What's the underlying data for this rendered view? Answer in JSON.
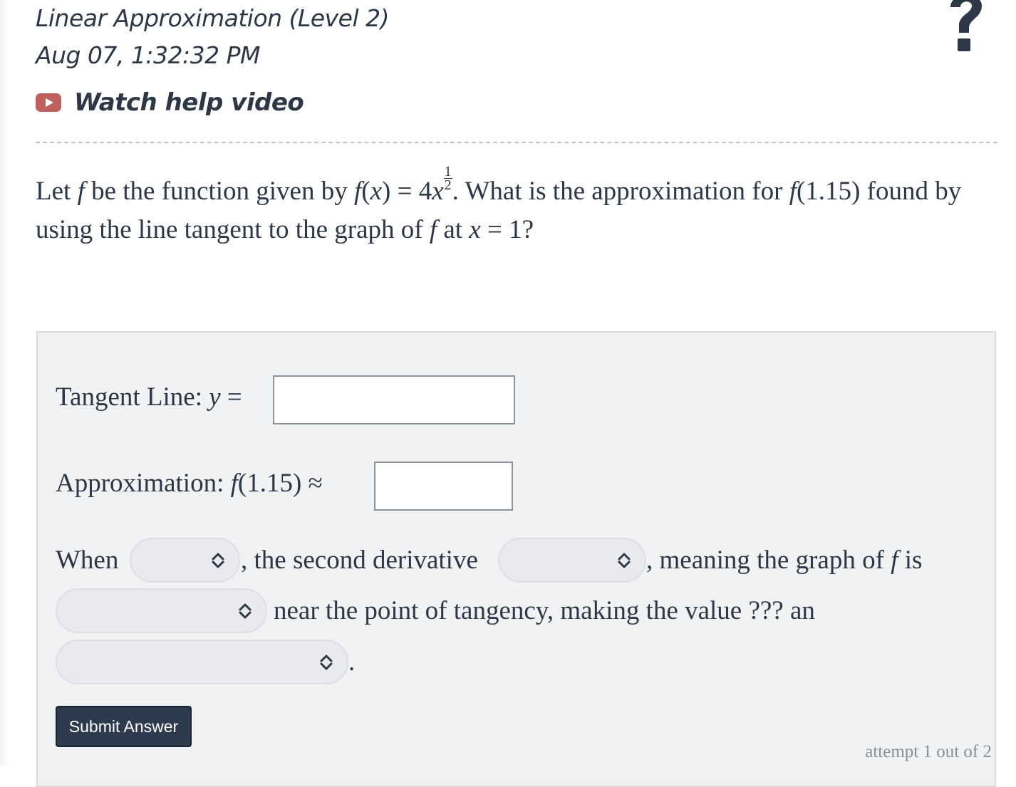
{
  "header": {
    "title": "Linear Approximation (Level 2)",
    "timestamp": "Aug 07, 1:32:32 PM",
    "help_icon": "question-mark-icon",
    "video_icon": "play-video-icon",
    "video_label": "Watch help video"
  },
  "question": {
    "p1": "Let ",
    "f": "f",
    "p2": " be the function given by ",
    "fx_open": "(",
    "x": "x",
    "fx_close": ")",
    "eq": " = 4",
    "exp_num": "1",
    "exp_den": "2",
    "p3": ". What is the approximation for ",
    "arg": "(1.15)",
    "p4": " found by using the line tangent to the graph of ",
    "p5": " at ",
    "p6": " = 1?"
  },
  "form": {
    "tangent_label": "Tangent Line: ",
    "tangent_var": "y",
    "tangent_eq": " =",
    "approx_label": "Approximation: ",
    "approx_f": "f",
    "approx_arg": "(1.15) ≈",
    "tangent_value": "",
    "approx_value": "",
    "s_when": "When",
    "s_second": ", the second derivative",
    "s_meaning": ", meaning the graph of ",
    "s_f": "f",
    "s_is": " is",
    "s_near": "near the point of tangency, making the value ??? an",
    "s_period": ".",
    "select_1": "",
    "select_2": "",
    "select_3": "",
    "select_4": ""
  },
  "actions": {
    "submit_label": "Submit Answer",
    "attempt_text": "attempt 1 out of 2"
  },
  "colors": {
    "text": "#2d3746",
    "video_icon": "#c0605f",
    "submit_bg": "#2e3a4d",
    "panel_bg": "#f1f2f4"
  }
}
